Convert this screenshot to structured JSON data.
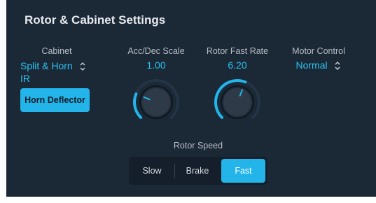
{
  "title": "Rotor & Cabinet Settings",
  "cabinet": {
    "label": "Cabinet",
    "value_line1": "Split & Horn",
    "value_line2": "IR",
    "chevron_icon": "up-down-chevron-icon",
    "horn_deflector_label": "Horn Deflector"
  },
  "acc_dec": {
    "label": "Acc/Dec Scale",
    "value": "1.00",
    "level": 0.25
  },
  "rotor_fast": {
    "label": "Rotor Fast Rate",
    "value": "6.20",
    "level": 0.58
  },
  "motor_control": {
    "label": "Motor Control",
    "value": "Normal",
    "chevron_icon": "up-down-chevron-icon"
  },
  "rotor_speed": {
    "label": "Rotor Speed",
    "options": [
      "Slow",
      "Brake",
      "Fast"
    ],
    "selected": "Fast"
  },
  "colors": {
    "accent": "#23b4ea",
    "panel_bg": "#1b2836",
    "value_text": "#29c3f3"
  }
}
